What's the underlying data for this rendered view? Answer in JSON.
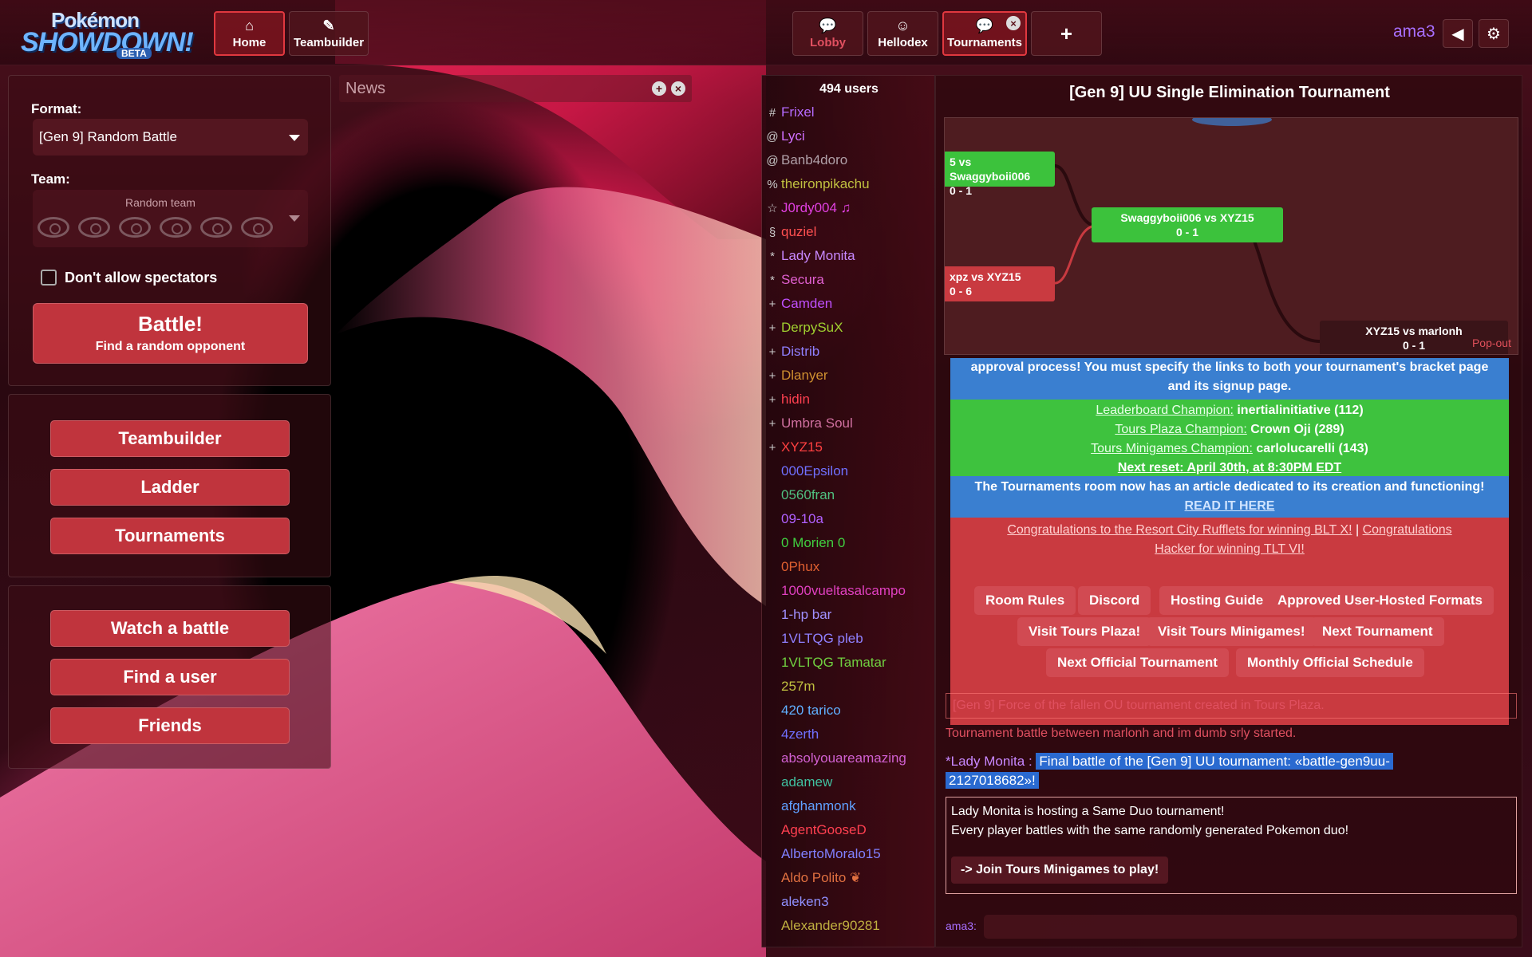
{
  "app": {
    "logo_line1": "Pokémon",
    "logo_line2": "SHOWDOWN!",
    "logo_badge": "BETA"
  },
  "header": {
    "nav_left": [
      {
        "label": "Home",
        "icon": "home-icon"
      },
      {
        "label": "Teambuilder",
        "icon": "edit-icon"
      }
    ],
    "room_tabs": [
      {
        "label": "Lobby",
        "icon": "chat-bubble-icon"
      },
      {
        "label": "Hellodex",
        "icon": "smiley-icon"
      },
      {
        "label": "Tournaments",
        "icon": "chat-bubble-icon"
      }
    ],
    "add_tab": "+",
    "username": "ama3"
  },
  "battle_panel": {
    "format_label": "Format:",
    "format_value": "[Gen 9] Random Battle",
    "team_label": "Team:",
    "team_value": "Random team",
    "spectators_label": "Don't allow spectators",
    "battle_title": "Battle!",
    "battle_subtitle": "Find a random opponent"
  },
  "menu1": [
    "Teambuilder",
    "Ladder",
    "Tournaments"
  ],
  "menu2": [
    "Watch a battle",
    "Find a user",
    "Friends"
  ],
  "news": {
    "title": "News"
  },
  "userlist": {
    "count": "494 users",
    "users": [
      {
        "rank": "#",
        "name": "Frixel",
        "color": "#b56bff"
      },
      {
        "rank": "@",
        "name": "Lyci",
        "color": "#d070ff"
      },
      {
        "rank": "@",
        "name": "Banb4doro",
        "color": "#b0a0a8"
      },
      {
        "rank": "%",
        "name": "theironpikachu",
        "color": "#c0c040"
      },
      {
        "rank": "☆",
        "name": "J0rdy004 ♫",
        "color": "#e040e0"
      },
      {
        "rank": "§",
        "name": "quziel",
        "color": "#ff5050"
      },
      {
        "rank": "*",
        "name": "Lady Monita",
        "color": "#c888ff"
      },
      {
        "rank": "*",
        "name": "Secura",
        "color": "#e060d0"
      },
      {
        "rank": "+",
        "name": "Camden",
        "color": "#c050ff"
      },
      {
        "rank": "+",
        "name": "DerpySuX",
        "color": "#a0d030"
      },
      {
        "rank": "+",
        "name": "Distrib",
        "color": "#9080ff"
      },
      {
        "rank": "+",
        "name": "Dlanyer",
        "color": "#d09030"
      },
      {
        "rank": "+",
        "name": "hidin",
        "color": "#ff4050"
      },
      {
        "rank": "+",
        "name": "Umbra Soul",
        "color": "#d070a0"
      },
      {
        "rank": "+",
        "name": "XYZ15",
        "color": "#ff4040"
      },
      {
        "rank": "",
        "name": "000Epsilon",
        "color": "#7070ff"
      },
      {
        "rank": "",
        "name": "0560fran",
        "color": "#50c080"
      },
      {
        "rank": "",
        "name": "09-10a",
        "color": "#b060ff"
      },
      {
        "rank": "",
        "name": "0 Morien 0",
        "color": "#40d040"
      },
      {
        "rank": "",
        "name": "0Phux",
        "color": "#e06030"
      },
      {
        "rank": "",
        "name": "1000vueltasalcampo",
        "color": "#e040c0"
      },
      {
        "rank": "",
        "name": "1-hp bar",
        "color": "#a090ff"
      },
      {
        "rank": "",
        "name": "1VLTQG pleb",
        "color": "#9080ff"
      },
      {
        "rank": "",
        "name": "1VLTQG Tamatar",
        "color": "#70d040"
      },
      {
        "rank": "",
        "name": "257m",
        "color": "#c0c040"
      },
      {
        "rank": "",
        "name": "420 tarico",
        "color": "#60b0ff"
      },
      {
        "rank": "",
        "name": "4zerth",
        "color": "#7070ff"
      },
      {
        "rank": "",
        "name": "absolyouareamazing",
        "color": "#d060d0"
      },
      {
        "rank": "",
        "name": "adamew",
        "color": "#40c0a0"
      },
      {
        "rank": "",
        "name": "afghanmonk",
        "color": "#60a0ff"
      },
      {
        "rank": "",
        "name": "AgentGooseD",
        "color": "#ff4050"
      },
      {
        "rank": "",
        "name": "AlbertoMoralo15",
        "color": "#8080ff"
      },
      {
        "rank": "",
        "name": "Aldo Polito ❦",
        "color": "#e07040"
      },
      {
        "rank": "",
        "name": "aleken3",
        "color": "#9090ff"
      },
      {
        "rank": "",
        "name": "Alexander90281",
        "color": "#c0b040"
      }
    ]
  },
  "chat": {
    "title": "[Gen 9] UU Single Elimination Tournament",
    "bracket": {
      "nodes": [
        {
          "line1": "5 vs Swaggyboii006",
          "line2": "0 - 1"
        },
        {
          "line1": "xpz vs XYZ15",
          "line2": "0 - 6"
        },
        {
          "line1": "Swaggyboii006 vs XYZ15",
          "line2": "0 - 1"
        },
        {
          "line1": "XYZ15 vs marlonh",
          "line2": "0 - 1"
        }
      ],
      "popout": "Pop-out"
    },
    "intro_blue_1": "approval process! You must specify the links to both your tournament's bracket page",
    "intro_blue_2": "and its signup page.",
    "champ_leaderboard_link": "Leaderboard Champion:",
    "champ_leaderboard_val": "inertialinitiative (112)",
    "champ_plaza_link": "Tours Plaza Champion:",
    "champ_plaza_val": "Crown Oji (289)",
    "champ_minigames_link": "Tours Minigames Champion:",
    "champ_minigames_val": "carlolucarelli (143)",
    "next_reset": "Next reset: April 30th, at 8:30PM EDT",
    "article_text": "The Tournaments room now has an article dedicated to its creation and functioning!",
    "article_link": "READ IT HERE",
    "congrats_1": "Congratulations to the Resort City Rufflets for winning BLT X!",
    "congrats_sep": "|",
    "congrats_2a": "Congratulations",
    "congrats_2b": "Hacker for winning TLT VI!",
    "pills": [
      "Room Rules",
      "Discord",
      "Hosting Guide",
      "Approved User-Hosted Formats",
      "Visit Tours Plaza!",
      "Visit Tours Minigames!",
      "Next Tournament",
      "Next Official Tournament",
      "Monthly Official Schedule"
    ],
    "msg_created": "[Gen 9] Force of the fallen OU tournament created in Tours Plaza.",
    "msg_battle": "Tournament battle between marlonh and im dumb srly started.",
    "msg_user": "*Lady Monita :",
    "msg_final_1": "Final battle of the [Gen 9] UU tournament: «battle-gen9uu-",
    "msg_final_2": "2127018682»!",
    "host_line1": "Lady Monita is hosting a Same Duo tournament!",
    "host_line2": "Every player battles with the same randomly generated Pokemon duo!",
    "join_btn": "-> Join Tours Minigames to play!",
    "input_label": "ama3:"
  }
}
